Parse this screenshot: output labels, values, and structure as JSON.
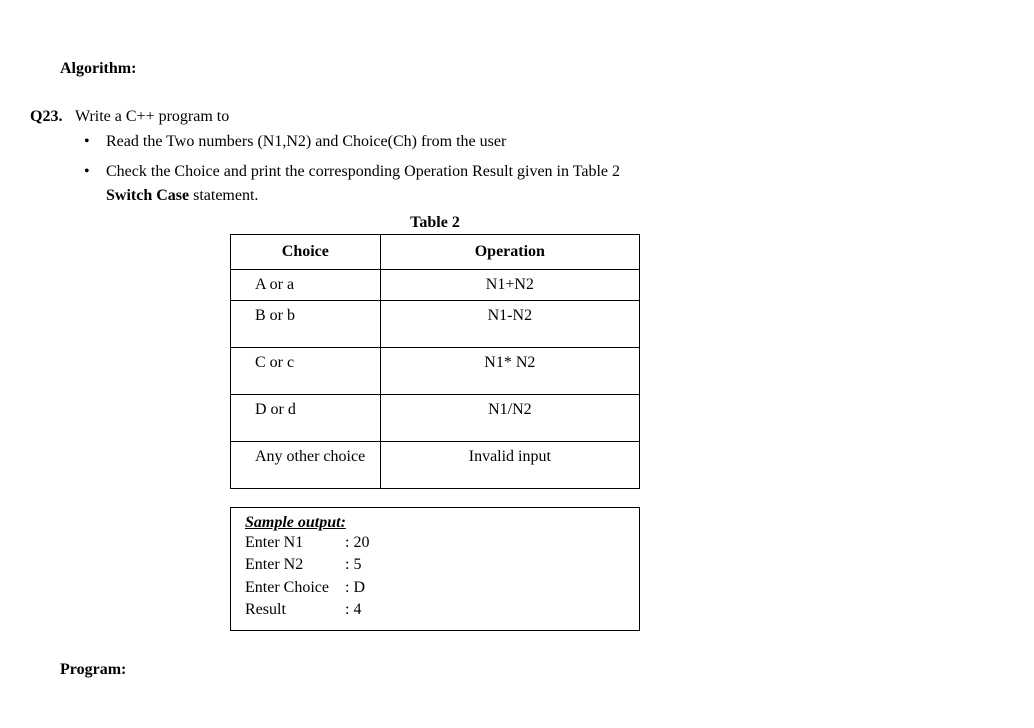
{
  "headings": {
    "algorithm": "Algorithm:",
    "program": "Program:"
  },
  "question": {
    "number": "Q23.",
    "prompt": "Write a C++ program to",
    "bullets": {
      "b1": "Read the Two numbers (N1,N2) and Choice(Ch) from the user",
      "b2_part1": "Check the Choice and print the corresponding Operation Result given in Table 2",
      "b2_bold": "Switch Case",
      "b2_part2": " statement."
    }
  },
  "table": {
    "caption": "Table 2",
    "headers": {
      "choice": "Choice",
      "operation": "Operation"
    },
    "rows": {
      "r1": {
        "choice": "A or a",
        "operation": "N1+N2"
      },
      "r2": {
        "choice": "B or b",
        "operation": "N1-N2"
      },
      "r3": {
        "choice": "C or c",
        "operation": "N1* N2"
      },
      "r4": {
        "choice": "D or d",
        "operation": "N1/N2"
      },
      "r5": {
        "choice": "Any other choice",
        "operation": "Invalid input"
      }
    }
  },
  "sample": {
    "title": "Sample output:",
    "lines": {
      "l1": {
        "label": "Enter N1",
        "value": ": 20"
      },
      "l2": {
        "label": "Enter N2",
        "value": ": 5"
      },
      "l3": {
        "label": "Enter Choice",
        "value": ": D"
      },
      "l4": {
        "label": "Result",
        "value": ":  4"
      }
    }
  }
}
